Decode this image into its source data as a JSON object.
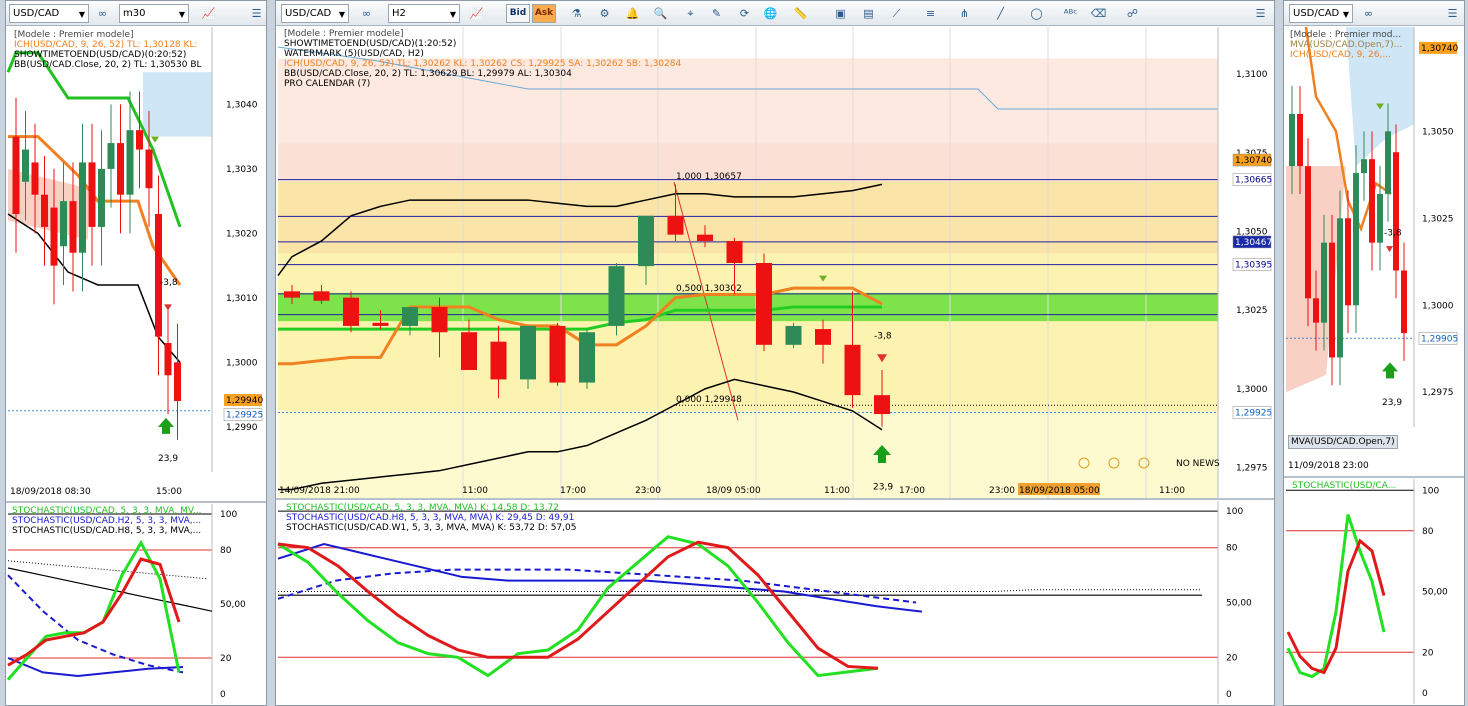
{
  "panels": {
    "left": {
      "symbol": "USD/CAD",
      "timeframe": "m30",
      "legend": [
        "[Modele : Premier modele]",
        "ICH(USD/CAD, 9, 26, 52)  TL: 1,30128  KL:",
        "SHOWTIMETOEND(USD/CAD)(0:20:52)",
        "BB(USD/CAD.Close, 20, 2)  TL: 1,30530  BL"
      ],
      "yticks": [
        "1,3040",
        "1,3030",
        "1,3020",
        "1,3010",
        "1,3000",
        "1,2990"
      ],
      "price_tags": [
        "1,29940",
        "1,29925"
      ],
      "date_start": "18/09/2018 08:30",
      "date_mid": "15:00",
      "signal_down": "-3,8",
      "signal_up": "23,9",
      "stoch_legend": [
        "STOCHASTIC(USD/CAD, 5, 3, 3, MVA, MV...",
        "STOCHASTIC(USD/CAD.H2, 5, 3, 3, MVA,...",
        "STOCHASTIC(USD/CAD.H8, 5, 3, 3, MVA,..."
      ],
      "stoch_ticks": [
        "100",
        "80",
        "50,00",
        "20",
        "0"
      ]
    },
    "middle": {
      "symbol": "USD/CAD",
      "timeframe": "H2",
      "bid_label": "Bid",
      "ask_label": "Ask",
      "legend": [
        {
          "text": "[Modele : Premier modele]",
          "color": "#000"
        },
        {
          "text": "SHOWTIMETOEND(USD/CAD)(1:20:52)",
          "color": "#000"
        },
        {
          "text": "WATERMARK (5)(USD/CAD, H2)",
          "color": "#000"
        },
        {
          "text": "ICH(USD/CAD, 9, 26, 52)  TL: 1,30262  KL: 1,30262  CS: 1,29925  SA: 1,30262  SB: 1,30284",
          "color": "#f08020"
        },
        {
          "text": "BB(USD/CAD.Close, 20, 2)  TL: 1,30629  BL: 1,29979  AL: 1,30304",
          "color": "#000"
        },
        {
          "text": "PRO CALENDAR (7)",
          "color": "#000"
        }
      ],
      "yticks": [
        "1,3100",
        "1,3075",
        "1,3050",
        "1,3025",
        "1,3000",
        "1,2975"
      ],
      "price_tags": [
        "1,30740",
        "1,30665",
        "1,30467",
        "1,30395",
        "1,29925"
      ],
      "fib": [
        "1,000  1,30657",
        "0,500  1,30302",
        "0,000  1,29948"
      ],
      "xlabels": [
        "14/09/2018 21:00",
        "11:00",
        "17:00",
        "23:00",
        "18/09 05:00",
        "11:00",
        "17:00",
        "23:00",
        "18/09/2018 05:00",
        "11:00"
      ],
      "no_news": "NO NEWS",
      "signal_down": "-3,8",
      "signal_up": "23,9",
      "stoch_legend": [
        {
          "text": "STOCHASTIC(USD/CAD, 5, 3, 3, MVA, MVA)  K: 14,58  D: 13,72",
          "color": "#22c022"
        },
        {
          "text": "STOCHASTIC(USD/CAD.H8, 5, 3, 3, MVA, MVA)  K: 29,45  D: 49,91",
          "color": "#1a1ad0"
        },
        {
          "text": "STOCHASTIC(USD/CAD.W1, 5, 3, 3, MVA, MVA)  K: 53,72  D: 57,05",
          "color": "#000"
        }
      ],
      "stoch_ticks": [
        "100",
        "80",
        "50,00",
        "20",
        "0"
      ]
    },
    "right": {
      "symbol": "USD/CAD",
      "legend": [
        "[Modele : Premier mod...",
        "MVA(USD/CAD.Open,7)...",
        "ICH(USD/CAD, 9, 26,..."
      ],
      "yticks": [
        "1,3050",
        "1,3025",
        "1,3000",
        "1,2975"
      ],
      "price_tags": [
        "1,30740",
        "1,29905"
      ],
      "mva_label": "MVA(USD/CAD.Open,7)",
      "date_start": "11/09/2018 23:00",
      "signal_down": "-3,8",
      "signal_up": "23,9",
      "stoch_legend": [
        "STOCHASTIC(USD/CA..."
      ],
      "stoch_ticks": [
        "100",
        "80",
        "50,00",
        "20",
        "0"
      ]
    }
  },
  "colors": {
    "bull": "#2e8b57",
    "bear": "#ee1111",
    "ichimoku": "#f08020",
    "kijun": "#22cc22",
    "bb": "#000000",
    "cloud_blue": "#cfe6f7"
  },
  "chart_data": [
    {
      "type": "candlestick",
      "title": "USD/CAD H2",
      "ylim": [
        1.2965,
        1.3115
      ],
      "candles": [
        {
          "o": 1.3031,
          "h": 1.3033,
          "l": 1.3027,
          "c": 1.3029
        },
        {
          "o": 1.3031,
          "h": 1.3033,
          "l": 1.3027,
          "c": 1.3028
        },
        {
          "o": 1.3029,
          "h": 1.3031,
          "l": 1.3018,
          "c": 1.302
        },
        {
          "o": 1.3021,
          "h": 1.3025,
          "l": 1.3019,
          "c": 1.302
        },
        {
          "o": 1.302,
          "h": 1.3026,
          "l": 1.3017,
          "c": 1.3026
        },
        {
          "o": 1.3026,
          "h": 1.3029,
          "l": 1.301,
          "c": 1.3018
        },
        {
          "o": 1.3018,
          "h": 1.3022,
          "l": 1.3006,
          "c": 1.3006
        },
        {
          "o": 1.3015,
          "h": 1.302,
          "l": 1.2997,
          "c": 1.3003
        },
        {
          "o": 1.3003,
          "h": 1.302,
          "l": 1.3,
          "c": 1.302
        },
        {
          "o": 1.302,
          "h": 1.3021,
          "l": 1.3001,
          "c": 1.3002
        },
        {
          "o": 1.3002,
          "h": 1.3019,
          "l": 1.3,
          "c": 1.3018
        },
        {
          "o": 1.302,
          "h": 1.304,
          "l": 1.3017,
          "c": 1.3039
        },
        {
          "o": 1.3039,
          "h": 1.3055,
          "l": 1.3033,
          "c": 1.3055
        },
        {
          "o": 1.3055,
          "h": 1.3065,
          "l": 1.3047,
          "c": 1.3049
        },
        {
          "o": 1.3049,
          "h": 1.3052,
          "l": 1.3045,
          "c": 1.3047
        },
        {
          "o": 1.3047,
          "h": 1.3048,
          "l": 1.303,
          "c": 1.304
        },
        {
          "o": 1.304,
          "h": 1.3043,
          "l": 1.3012,
          "c": 1.3014
        },
        {
          "o": 1.3014,
          "h": 1.3021,
          "l": 1.3013,
          "c": 1.302
        },
        {
          "o": 1.3019,
          "h": 1.3022,
          "l": 1.3008,
          "c": 1.3014
        },
        {
          "o": 1.3014,
          "h": 1.3031,
          "l": 1.2994,
          "c": 1.2998
        },
        {
          "o": 1.2998,
          "h": 1.3006,
          "l": 1.2988,
          "c": 1.2992
        }
      ],
      "bb_upper": [
        1.3042,
        1.3047,
        1.3055,
        1.3058,
        1.306,
        1.306,
        1.306,
        1.306,
        1.306,
        1.3059,
        1.3058,
        1.3058,
        1.306,
        1.3062,
        1.3062,
        1.3061,
        1.3061,
        1.3061,
        1.3062,
        1.3063,
        1.3065
      ],
      "bb_lower": [
        1.2968,
        1.297,
        1.2971,
        1.2972,
        1.2973,
        1.2974,
        1.2976,
        1.2978,
        1.298,
        1.298,
        1.2982,
        1.2986,
        1.299,
        1.2995,
        1.3,
        1.3003,
        1.3001,
        1.2999,
        1.2996,
        1.2993,
        1.2987
      ],
      "tenkan": [
        1.3008,
        1.3009,
        1.301,
        1.301,
        1.3026,
        1.3026,
        1.3026,
        1.3022,
        1.302,
        1.302,
        1.3014,
        1.3014,
        1.302,
        1.3029,
        1.303,
        1.303,
        1.303,
        1.3032,
        1.3032,
        1.3032,
        1.3027
      ],
      "kijun": [
        1.3019,
        1.3019,
        1.3019,
        1.3019,
        1.3019,
        1.3019,
        1.3019,
        1.3019,
        1.3019,
        1.3019,
        1.3019,
        1.3021,
        1.3022,
        1.3025,
        1.3025,
        1.3025,
        1.3025,
        1.3026,
        1.3026,
        1.3026,
        1.3026
      ],
      "fib_levels": {
        "1.000": 1.30657,
        "0.500": 1.30302,
        "0.000": 1.29948
      }
    },
    {
      "type": "line",
      "title": "Stochastic H2",
      "ylim": [
        0,
        100
      ],
      "levels": [
        20,
        80
      ],
      "series": [
        {
          "name": "STOCHASTIC(USD/CAD, 5, 3, 3, MVA, MVA) K",
          "values": [
            82,
            72,
            55,
            40,
            28,
            22,
            20,
            10,
            22,
            24,
            35,
            58,
            72,
            86,
            82,
            70,
            50,
            28,
            10,
            12,
            14
          ]
        },
        {
          "name": "STOCHASTIC(USD/CAD, 5, 3, 3, MVA, MVA) D",
          "values": [
            82,
            80,
            70,
            56,
            43,
            32,
            24,
            20,
            20,
            20,
            30,
            45,
            60,
            75,
            83,
            80,
            65,
            45,
            25,
            15,
            14
          ]
        },
        {
          "name": "STOCHASTIC(USD/CAD.H8) K",
          "values": [
            74,
            82,
            76,
            70,
            64,
            62,
            62,
            62,
            62,
            60,
            58,
            56,
            52,
            48,
            45
          ]
        },
        {
          "name": "STOCHASTIC(USD/CAD.H8) D",
          "values": [
            52,
            62,
            66,
            68,
            68,
            68,
            66,
            64,
            62,
            58,
            54,
            50
          ]
        },
        {
          "name": "STOCHASTIC(USD/CAD.W1) K",
          "values": [
            54,
            54,
            54,
            54,
            54,
            54,
            54,
            54,
            54,
            54,
            54,
            54,
            54,
            54,
            54,
            54,
            54,
            54,
            54,
            54,
            54,
            54,
            54
          ]
        },
        {
          "name": "STOCHASTIC(USD/CAD.W1) D",
          "values": [
            56,
            56,
            56,
            56,
            56,
            56,
            56,
            56,
            56,
            56,
            56,
            56,
            56,
            56,
            56,
            56,
            56,
            56,
            57,
            57,
            57,
            57,
            57
          ]
        }
      ]
    }
  ]
}
